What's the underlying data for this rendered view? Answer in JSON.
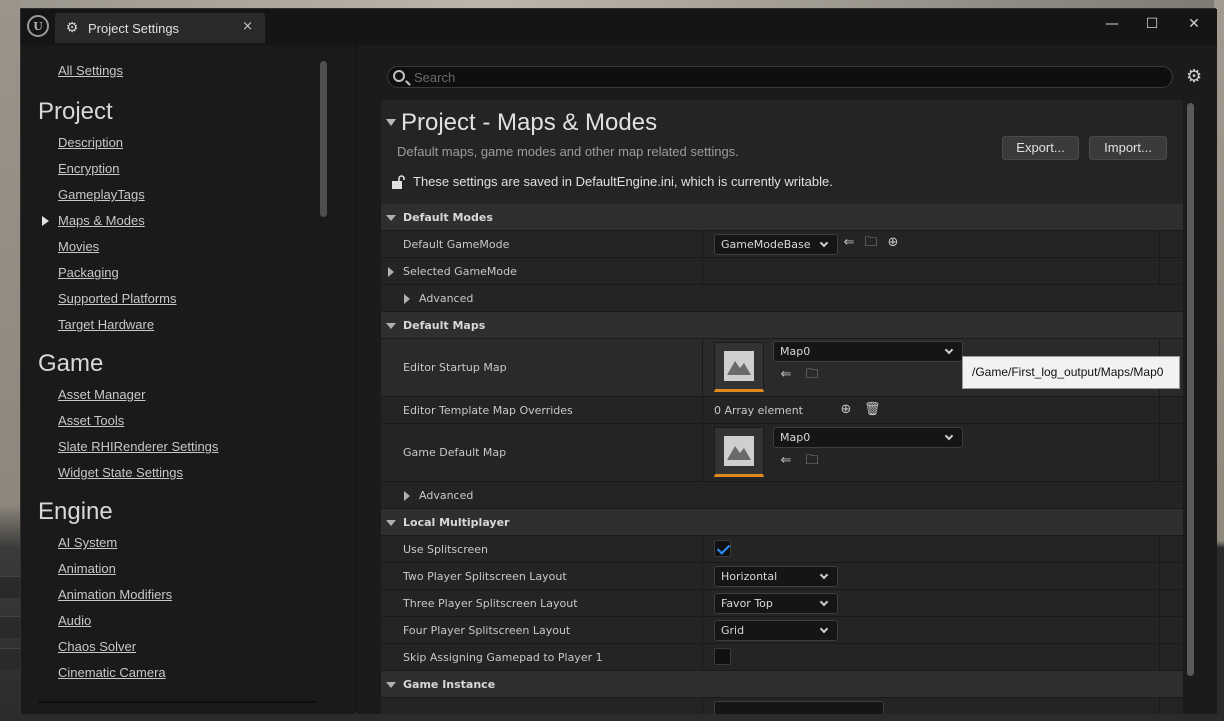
{
  "window": {
    "tab_title": "Project Settings",
    "close_glyph": "×",
    "controls": {
      "minimize": "—",
      "maximize": "☐",
      "close": "✕"
    }
  },
  "sidebar": {
    "all_settings": "All Settings",
    "sections": [
      {
        "title": "Project",
        "items": [
          "Description",
          "Encryption",
          "GameplayTags",
          "Maps & Modes",
          "Movies",
          "Packaging",
          "Supported Platforms",
          "Target Hardware"
        ]
      },
      {
        "title": "Game",
        "items": [
          "Asset Manager",
          "Asset Tools",
          "Slate RHIRenderer Settings",
          "Widget State Settings"
        ]
      },
      {
        "title": "Engine",
        "items": [
          "AI System",
          "Animation",
          "Animation Modifiers",
          "Audio",
          "Chaos Solver",
          "Cinematic Camera"
        ]
      }
    ],
    "active_item": "Maps & Modes"
  },
  "search": {
    "placeholder": "Search",
    "value": ""
  },
  "header": {
    "title": "Project - Maps & Modes",
    "description": "Default maps, game modes and other map related settings.",
    "export_label": "Export...",
    "import_label": "Import...",
    "writable_note": "These settings are saved in DefaultEngine.ini, which is currently writable."
  },
  "categories": {
    "default_modes": "Default Modes",
    "default_maps": "Default Maps",
    "local_multiplayer": "Local Multiplayer",
    "game_instance": "Game Instance"
  },
  "properties": {
    "default_gamemode": {
      "label": "Default GameMode",
      "value": "GameModeBase"
    },
    "selected_gamemode": {
      "label": "Selected GameMode"
    },
    "advanced_1": {
      "label": "Advanced"
    },
    "editor_startup_map": {
      "label": "Editor Startup Map",
      "value": "Map0"
    },
    "editor_template_overrides": {
      "label": "Editor Template Map Overrides",
      "value": "0 Array element"
    },
    "game_default_map": {
      "label": "Game Default Map",
      "value": "Map0"
    },
    "advanced_2": {
      "label": "Advanced"
    },
    "use_splitscreen": {
      "label": "Use Splitscreen",
      "checked": true
    },
    "two_player_layout": {
      "label": "Two Player Splitscreen Layout",
      "value": "Horizontal"
    },
    "three_player_layout": {
      "label": "Three Player Splitscreen Layout",
      "value": "Favor Top"
    },
    "four_player_layout": {
      "label": "Four Player Splitscreen Layout",
      "value": "Grid"
    },
    "skip_gamepad": {
      "label": "Skip Assigning Gamepad to Player 1",
      "checked": false
    }
  },
  "tooltip": {
    "text": "/Game/First_log_output/Maps/Map0"
  },
  "colors": {
    "accent_orange": "#e08a1c",
    "checkbox_blue": "#2f8fff"
  }
}
